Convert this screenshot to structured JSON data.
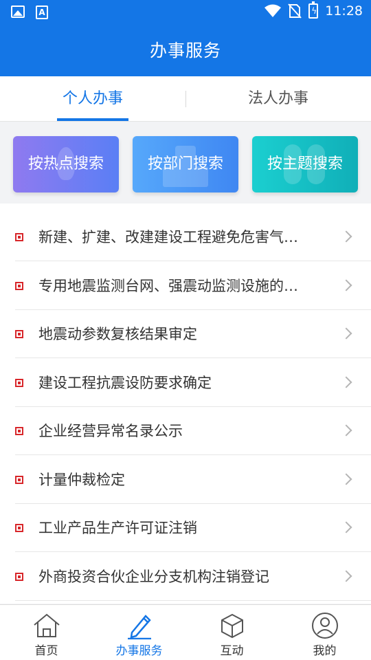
{
  "status_bar": {
    "time": "11:28"
  },
  "header": {
    "title": "办事服务"
  },
  "tabs": [
    {
      "label": "个人办事",
      "active": true
    },
    {
      "label": "法人办事",
      "active": false
    }
  ],
  "search_buttons": [
    {
      "label": "按热点搜索",
      "color_from": "#8f7af0",
      "color_to": "#5a7ff5"
    },
    {
      "label": "按部门搜索",
      "color_from": "#56a8fb",
      "color_to": "#3f87f2"
    },
    {
      "label": "按主题搜索",
      "color_from": "#1bcfd0",
      "color_to": "#10afb8"
    }
  ],
  "services": [
    "新建、扩建、改建建设工程避免危害气…",
    "专用地震监测台网、强震动监测设施的…",
    "地震动参数复核结果审定",
    "建设工程抗震设防要求确定",
    "企业经营异常名录公示",
    "计量仲裁检定",
    "工业产品生产许可证注销",
    "外商投资合伙企业分支机构注销登记"
  ],
  "bottom_nav": [
    {
      "label": "首页",
      "icon": "home-icon",
      "active": false
    },
    {
      "label": "办事服务",
      "icon": "pencil-icon",
      "active": true
    },
    {
      "label": "互动",
      "icon": "cube-icon",
      "active": false
    },
    {
      "label": "我的",
      "icon": "user-icon",
      "active": false
    }
  ],
  "colors": {
    "primary": "#1476e6",
    "bullet": "#d8272b"
  }
}
